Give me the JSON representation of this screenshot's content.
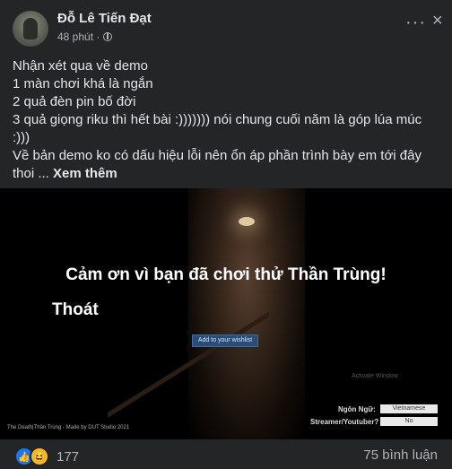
{
  "post": {
    "author": "Đỗ Lê Tiến Đạt",
    "time": "48 phút ·",
    "privacy_icon": "globe-icon",
    "more_label": "···",
    "close_label": "×",
    "lines": [
      "Nhận xét qua về demo",
      "1 màn chơi khá là ngắn",
      "2 quả đèn pin bố đời",
      "3 quả giọng riku thì hết bài :))))))) nói chung cuối năm là góp lúa múc",
      ":)))",
      "Về bản demo ko có dấu hiệu lỗi nên ổn áp phần trình bày em tới đây"
    ],
    "last_line_prefix": "thoi ...",
    "see_more": "Xem thêm"
  },
  "game": {
    "thanks": "Cảm ơn vì bạn đã chơi thử Thần Trùng!",
    "quit": "Thoát",
    "wishlist": "Add to your wishlist",
    "activate_watermark": "Activate Window",
    "language_label": "Ngôn Ngữ:",
    "language_value": "Vietnamese",
    "streamer_label": "Streamer/Youtuber?",
    "streamer_value": "No",
    "credit": "The Death|Thần Trùng - Made by DUT Studio 2021"
  },
  "footer": {
    "reaction_icons": [
      "like-icon",
      "haha-icon"
    ],
    "reaction_count": "177",
    "comment_count": "75 bình luận"
  }
}
